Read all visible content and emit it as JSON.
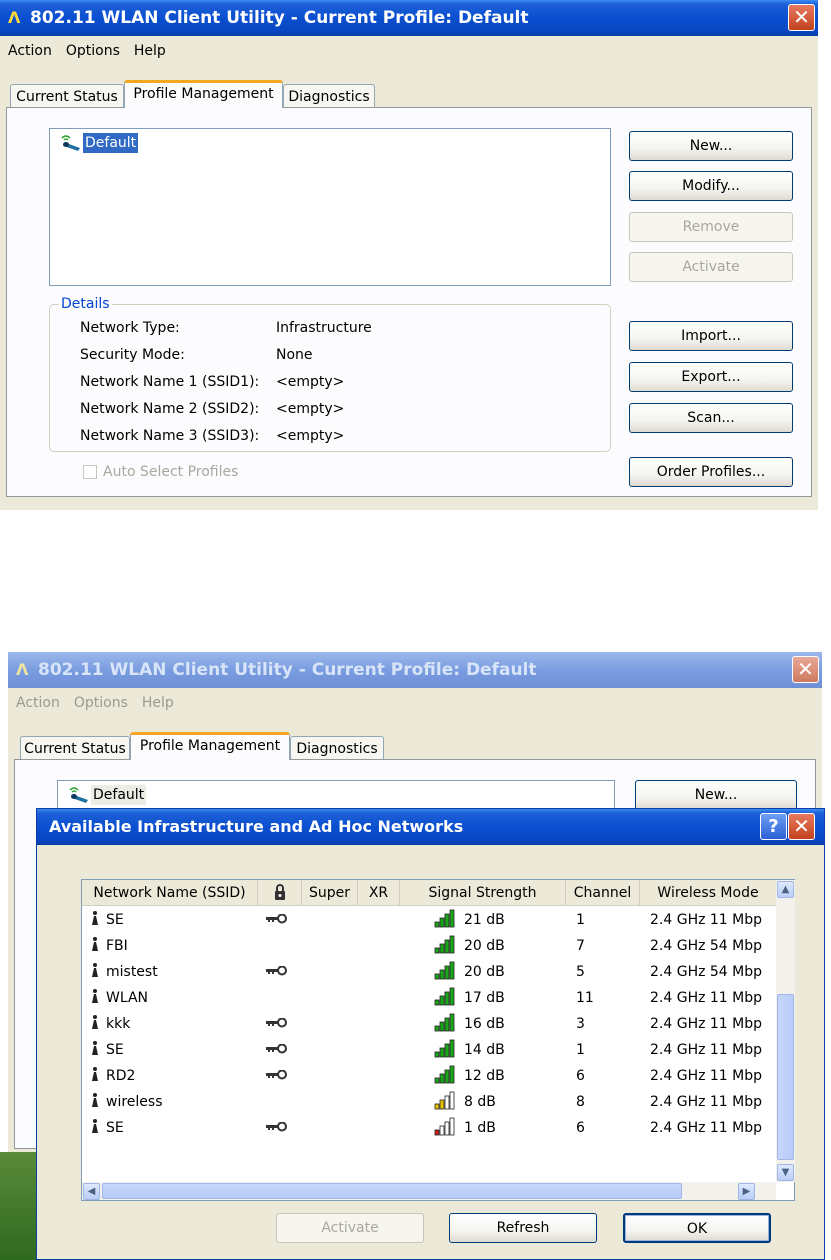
{
  "window1": {
    "title": "802.11 WLAN Client Utility - Current Profile: Default",
    "app_icon": "Λ",
    "close_glyph": "✕",
    "menu": [
      "Action",
      "Options",
      "Help"
    ],
    "tabs": [
      "Current Status",
      "Profile Management",
      "Diagnostics"
    ],
    "profiles": [
      "Default"
    ],
    "buttons": {
      "new": "New...",
      "modify": "Modify...",
      "remove": "Remove",
      "activate": "Activate",
      "import": "Import...",
      "export": "Export...",
      "scan": "Scan...",
      "order": "Order Profiles..."
    },
    "details": {
      "legend": "Details",
      "rows": [
        {
          "label": "Network Type:",
          "value": "Infrastructure"
        },
        {
          "label": "Security Mode:",
          "value": "None"
        },
        {
          "label": "Network Name 1 (SSID1):",
          "value": "<empty>"
        },
        {
          "label": "Network Name 2 (SSID2):",
          "value": "<empty>"
        },
        {
          "label": "Network Name 3 (SSID3):",
          "value": "<empty>"
        }
      ]
    },
    "auto_select": "Auto Select Profiles"
  },
  "window2": {
    "title": "802.11 WLAN Client Utility - Current Profile: Default",
    "app_icon": "Λ",
    "close_glyph": "✕",
    "menu": [
      "Action",
      "Options",
      "Help"
    ],
    "tabs": [
      "Current Status",
      "Profile Management",
      "Diagnostics"
    ],
    "profiles": [
      "Default"
    ],
    "new_button": "New..."
  },
  "dialog": {
    "title": "Available Infrastructure and Ad Hoc Networks",
    "help_glyph": "?",
    "close_glyph": "✕",
    "columns": [
      "Network Name (SSID)",
      "",
      "Super",
      "XR",
      "Signal Strength",
      "Channel",
      "Wireless Mode"
    ],
    "networks": [
      {
        "ssid": "SE",
        "secured": true,
        "signal": "21 dB",
        "bars": 4,
        "channel": "1",
        "mode": "2.4 GHz 11 Mbp"
      },
      {
        "ssid": "FBI",
        "secured": false,
        "signal": "20 dB",
        "bars": 4,
        "channel": "7",
        "mode": "2.4 GHz 54 Mbp"
      },
      {
        "ssid": "mistest",
        "secured": true,
        "signal": "20 dB",
        "bars": 4,
        "channel": "5",
        "mode": "2.4 GHz 54 Mbp"
      },
      {
        "ssid": "WLAN",
        "secured": false,
        "signal": "17 dB",
        "bars": 4,
        "channel": "11",
        "mode": "2.4 GHz 11 Mbp"
      },
      {
        "ssid": "kkk",
        "secured": true,
        "signal": "16 dB",
        "bars": 4,
        "channel": "3",
        "mode": "2.4 GHz 11 Mbp"
      },
      {
        "ssid": "SE",
        "secured": true,
        "signal": "14 dB",
        "bars": 4,
        "channel": "1",
        "mode": "2.4 GHz 11 Mbp"
      },
      {
        "ssid": "RD2",
        "secured": true,
        "signal": "12 dB",
        "bars": 4,
        "channel": "6",
        "mode": "2.4 GHz 11 Mbp"
      },
      {
        "ssid": "wireless",
        "secured": false,
        "signal": "8 dB",
        "bars": 2,
        "channel": "8",
        "mode": "2.4 GHz 11 Mbp"
      },
      {
        "ssid": "SE",
        "secured": true,
        "signal": "1 dB",
        "bars": 1,
        "channel": "6",
        "mode": "2.4 GHz 11 Mbp"
      }
    ],
    "buttons": {
      "activate": "Activate",
      "refresh": "Refresh",
      "ok": "OK"
    }
  },
  "colors": {
    "titlebar": "#0a4fd0",
    "selection": "#316ac5",
    "signal_green": "#1aa81a",
    "signal_yellow": "#e8c400",
    "signal_red": "#d21e1e",
    "legend_blue": "#0046d5"
  },
  "icons": {
    "app": "wlan-logo-icon",
    "profile": "wireless-profile-icon",
    "network": "access-point-icon",
    "secured": "key-icon",
    "security_column": "lock-column-icon"
  }
}
